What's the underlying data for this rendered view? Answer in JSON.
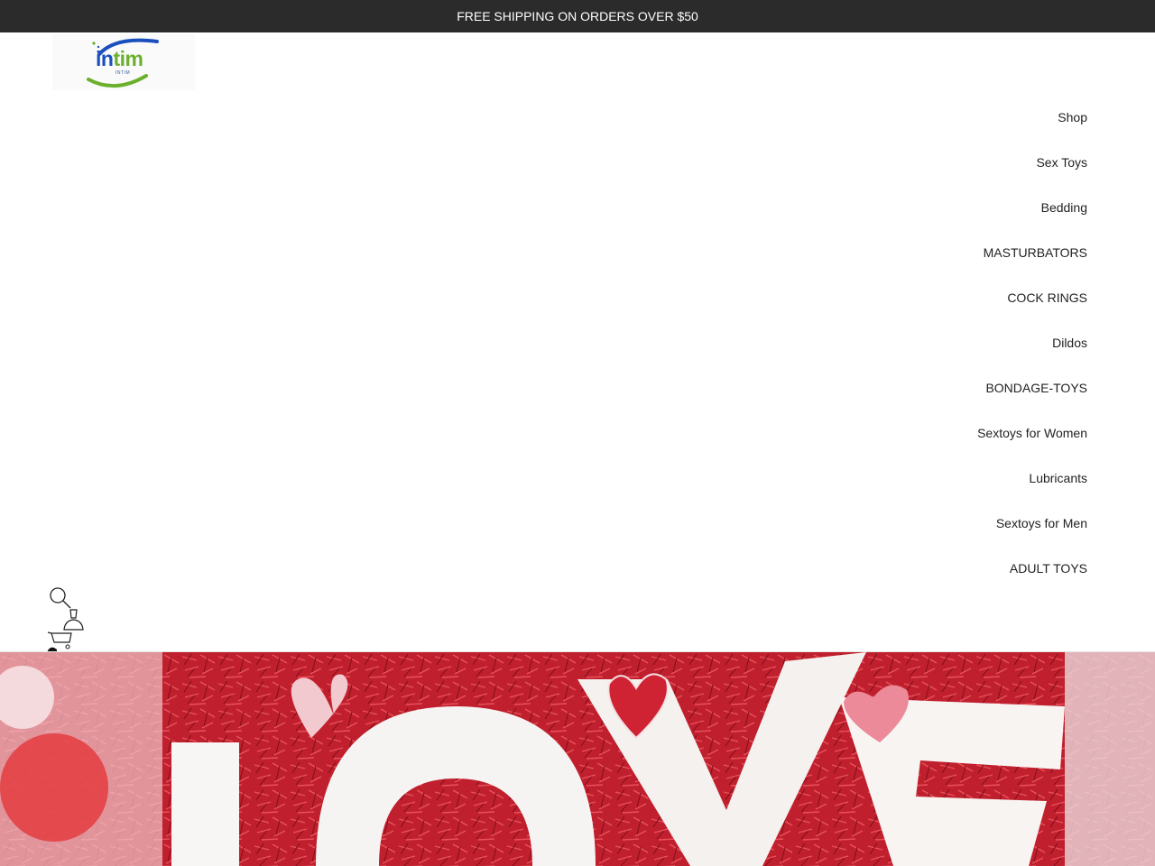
{
  "announcement": {
    "text": "FREE SHIPPING ON ORDERS OVER $50"
  },
  "logo": {
    "part1": "in",
    "part2": "tim",
    "subtext": "INTIM"
  },
  "nav": {
    "items": [
      {
        "label": "Shop"
      },
      {
        "label": "Sex Toys"
      },
      {
        "label": "Bedding"
      },
      {
        "label": "MASTURBATORS"
      },
      {
        "label": "COCK RINGS"
      },
      {
        "label": "Dildos"
      },
      {
        "label": "BONDAGE-TOYS"
      },
      {
        "label": "Sextoys for Women"
      },
      {
        "label": "Lubricants"
      },
      {
        "label": "Sextoys for Men"
      },
      {
        "label": "ADULT TOYS"
      }
    ]
  },
  "header_icons": [
    "search-icon",
    "account-icon",
    "cart-icon"
  ],
  "colors": {
    "announcement_bg": "#2b2b2b",
    "logo_blue": "#1b4fbd",
    "logo_green": "#6bb02d",
    "hero_red": "#b81d2a"
  }
}
